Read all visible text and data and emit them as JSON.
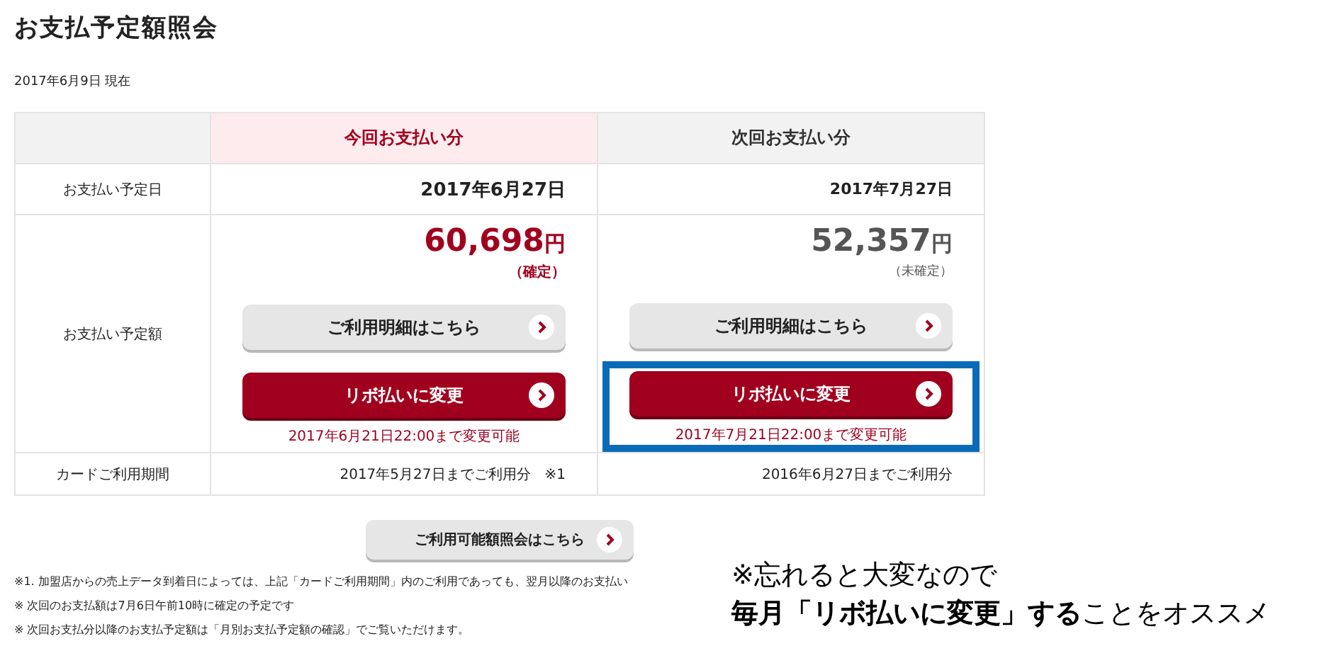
{
  "title": "お支払予定額照会",
  "as_of": "2017年6月9日 現在",
  "table": {
    "columns": [
      {
        "heading": "今回お支払い分",
        "current": true
      },
      {
        "heading": "次回お支払い分",
        "current": false
      }
    ],
    "due_date": {
      "label": "お支払い予定日",
      "values": [
        "2017年6月27日",
        "2017年7月27日"
      ]
    },
    "amount": {
      "label": "お支払い予定額",
      "cells": [
        {
          "amount": "60,698",
          "unit": "円",
          "status": "（確定）",
          "confirmed": true,
          "detail_button": "ご利用明細はこちら",
          "revo_button": "リボ払いに変更",
          "deadline": "2017年6月21日22:00まで変更可能",
          "highlighted": false
        },
        {
          "amount": "52,357",
          "unit": "円",
          "status": "（未確定）",
          "confirmed": false,
          "detail_button": "ご利用明細はこちら",
          "revo_button": "リボ払いに変更",
          "deadline": "2017年7月21日22:00まで変更可能",
          "highlighted": true
        }
      ]
    },
    "period": {
      "label": "カードご利用期間",
      "values": [
        "2017年5月27日までご利用分　※1",
        "2016年6月27日までご利用分"
      ]
    }
  },
  "limit_button": "ご利用可能額照会はこちら",
  "footnotes": [
    "※1. 加盟店からの売上データ到着日によっては、上記「カードご利用期間」内のご利用であっても、翌月以降のお支払い",
    "※ 次回のお支払額は7月6日午前10時に確定の予定です",
    "※ 次回お支払分以降のお支払予定額は「月別お支払予定額の確認」でご覧いただけます。"
  ],
  "callout": [
    "※忘れると大変なので",
    "**毎月「リボ払いに変更」する**ことをオススメ"
  ]
}
